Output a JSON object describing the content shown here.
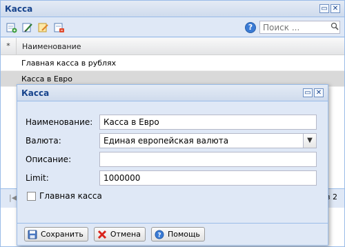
{
  "main_window": {
    "title": "Касса",
    "toolbar": {
      "icons": [
        "add-record-icon",
        "edit-record-icon",
        "edit-form-icon",
        "delete-record-icon"
      ],
      "help_icon": "help-icon",
      "search_placeholder": "Поиск ...",
      "search_icon": "search-icon"
    },
    "grid": {
      "star_header": "*",
      "column_header": "Наименование",
      "rows": [
        "Главная касса в рублях",
        "Касса в Евро"
      ],
      "selected_index": 1
    },
    "paging": {
      "of_text": "из 2"
    }
  },
  "dialog": {
    "title": "Касса",
    "fields": {
      "name_label": "Наименование:",
      "name_value": "Касса в Евро",
      "currency_label": "Валюта:",
      "currency_value": "Единая европейская валюта",
      "description_label": "Описание:",
      "description_value": "",
      "limit_label": "Limit:",
      "limit_value": "1000000"
    },
    "main_cash_label": "Главная касса",
    "main_cash_checked": false,
    "buttons": {
      "save": "Сохранить",
      "cancel": "Отмена",
      "help": "Помощь"
    }
  },
  "colors": {
    "frame_border": "#99bbe8",
    "panel_bg": "#dfe8f6",
    "title_text": "#15428b",
    "selected_row": "#d9d9d9"
  }
}
